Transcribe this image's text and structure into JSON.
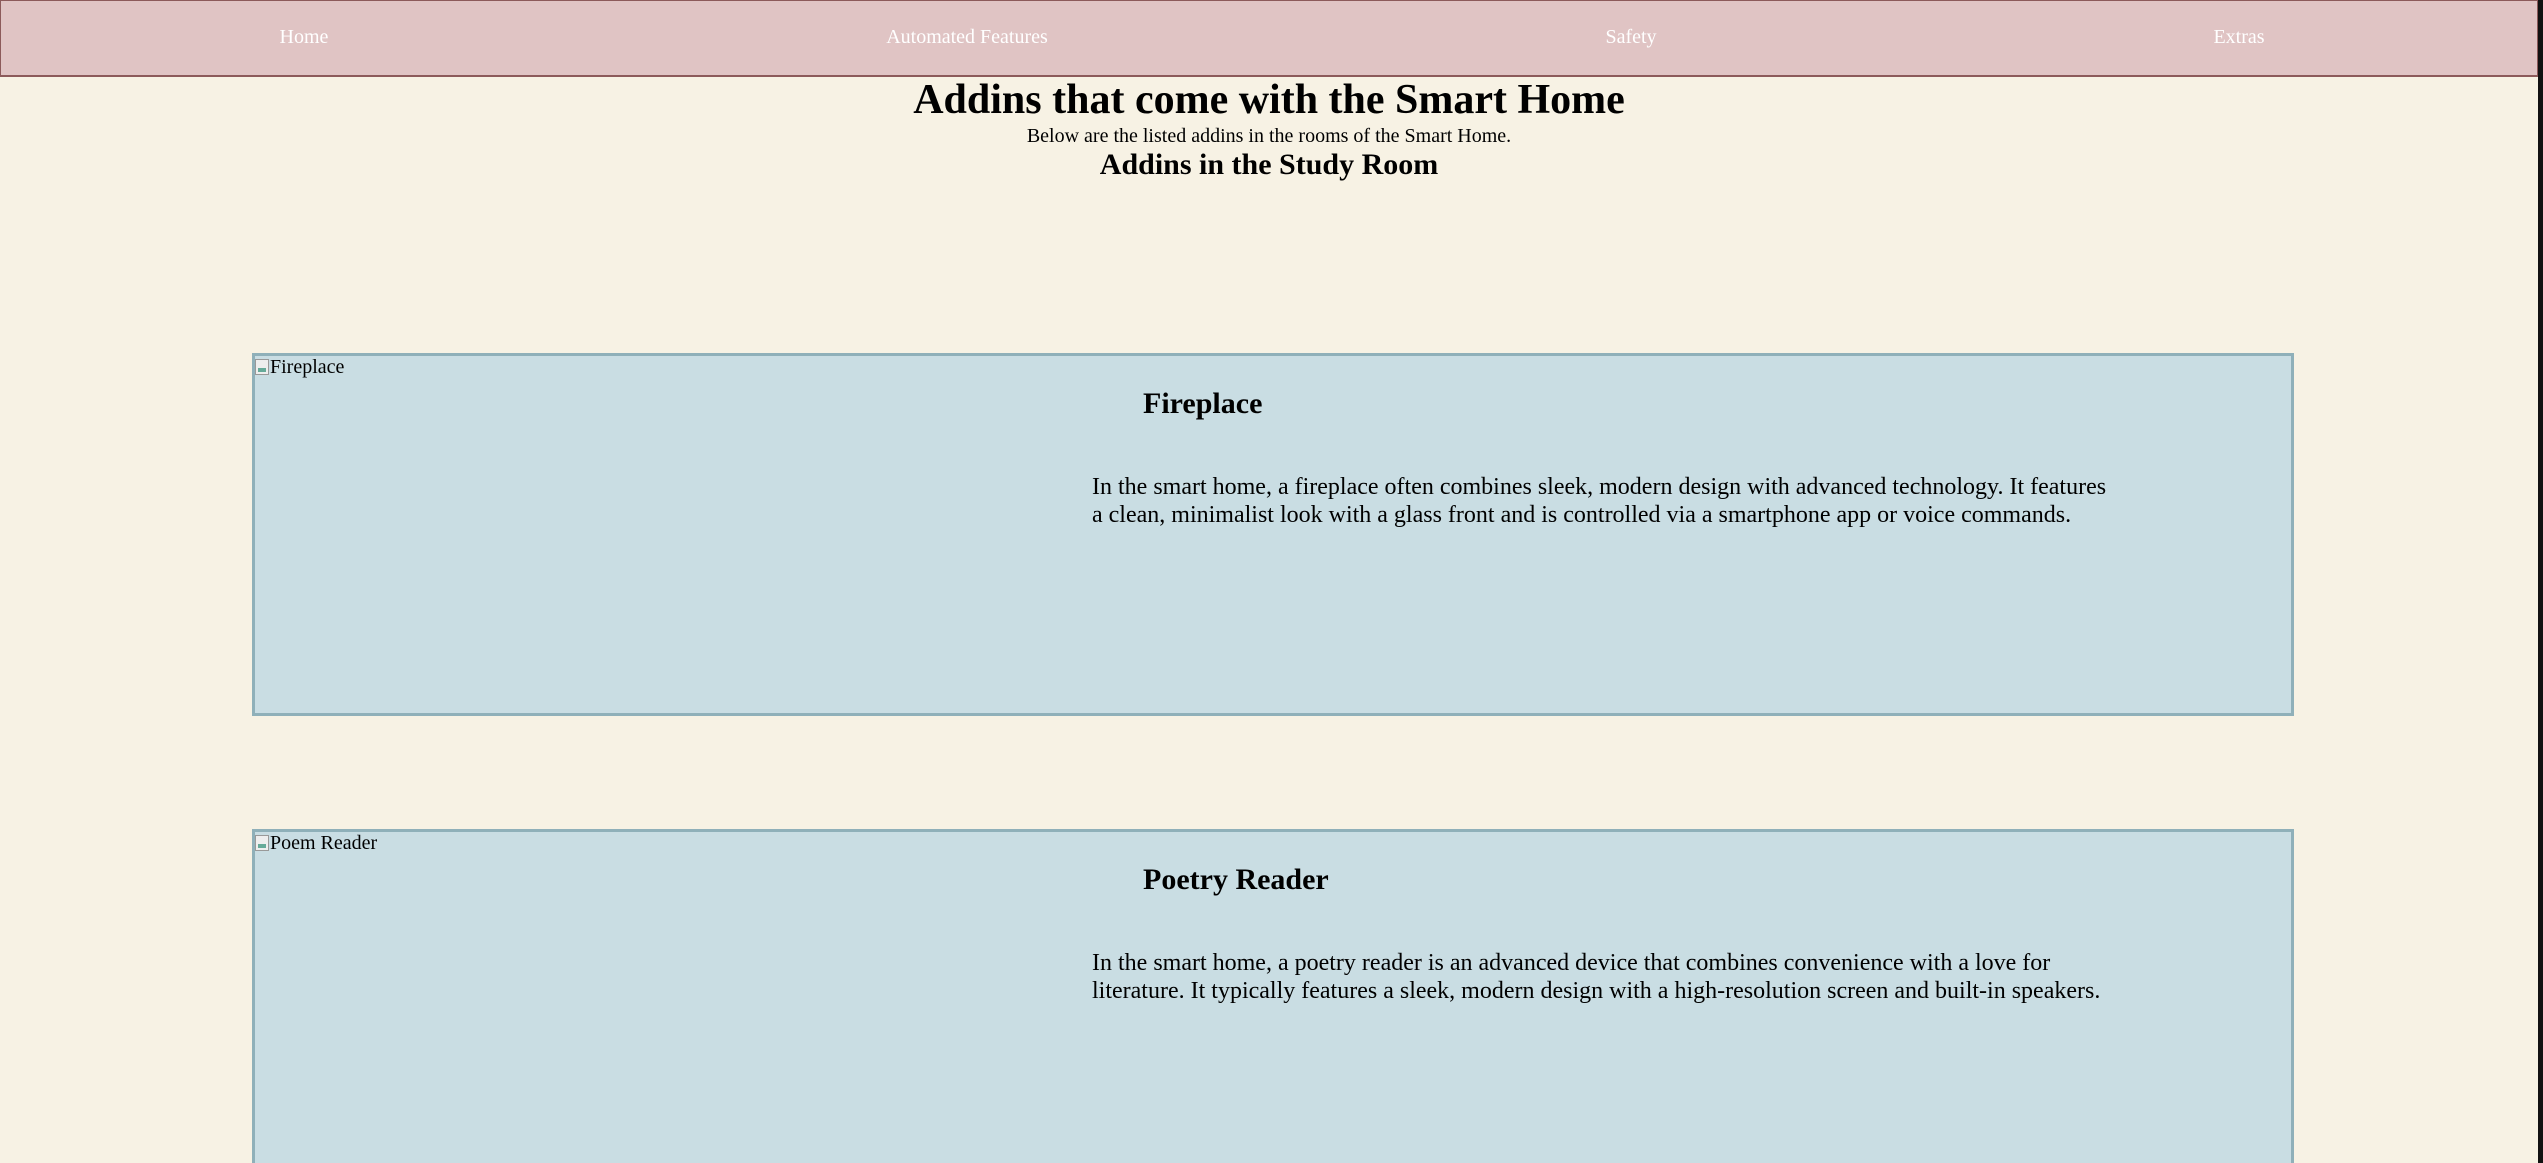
{
  "nav": {
    "items": [
      {
        "label": "Home"
      },
      {
        "label": "Automated Features"
      },
      {
        "label": "Safety"
      },
      {
        "label": "Extras"
      }
    ]
  },
  "header": {
    "title": "Addins that come with the Smart Home",
    "subtitle": "Below are the listed addins in the rooms of the Smart Home.",
    "section_title": "Addins in the Study Room"
  },
  "cards": [
    {
      "img_alt": "Fireplace",
      "heading": "Fireplace",
      "text": "In the smart home, a fireplace often combines sleek, modern design with advanced technology. It features a clean, minimalist look with a glass front and is controlled via a smartphone app or voice commands."
    },
    {
      "img_alt": "Poem Reader",
      "heading": "Poetry Reader",
      "text": "In the smart home, a poetry reader is an advanced device that combines convenience with a love for literature. It typically features a sleek, modern design with a high-resolution screen and built-in speakers."
    }
  ],
  "colors": {
    "background": "#f7f2e4",
    "navbar": "#e0c4c4",
    "card": "#c9dde3",
    "card_border": "#8fb0b9"
  }
}
